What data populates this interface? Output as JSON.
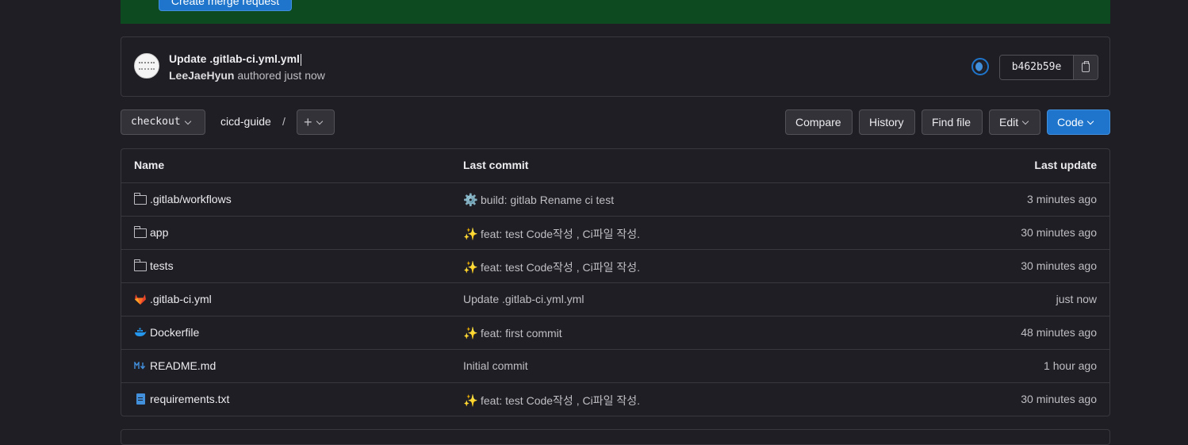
{
  "banner": {
    "button_label": "Create merge request"
  },
  "commit": {
    "title": "Update .gitlab-ci.yml.yml",
    "author": "LeeJaeHyun",
    "meta_suffix": "authored just now",
    "sha": "b462b59e"
  },
  "toolbar": {
    "branch": "checkout",
    "breadcrumb": "cicd-guide",
    "separator": "/",
    "add_symbol": "+",
    "compare": "Compare",
    "history": "History",
    "find_file": "Find file",
    "edit": "Edit",
    "code": "Code"
  },
  "table": {
    "headers": {
      "name": "Name",
      "last_commit": "Last commit",
      "last_update": "Last update"
    },
    "rows": [
      {
        "name": ".gitlab/workflows",
        "icon": "folder-icon",
        "commit_emoji": "⚙️",
        "commit": "build: gitlab Rename ci test",
        "updated": "3 minutes ago"
      },
      {
        "name": "app",
        "icon": "folder-icon",
        "commit_emoji": "✨",
        "commit": "feat: test Code작성 , Ci파일 작성.",
        "updated": "30 minutes ago"
      },
      {
        "name": "tests",
        "icon": "folder-icon",
        "commit_emoji": "✨",
        "commit": "feat: test Code작성 , Ci파일 작성.",
        "updated": "30 minutes ago"
      },
      {
        "name": ".gitlab-ci.yml",
        "icon": "gitlab-icon",
        "commit_emoji": "",
        "commit": "Update .gitlab-ci.yml.yml",
        "updated": "just now"
      },
      {
        "name": "Dockerfile",
        "icon": "docker-icon",
        "commit_emoji": "✨",
        "commit": "feat: first commit",
        "updated": "48 minutes ago"
      },
      {
        "name": "README.md",
        "icon": "markdown-icon",
        "commit_emoji": "",
        "commit": "Initial commit",
        "updated": "1 hour ago"
      },
      {
        "name": "requirements.txt",
        "icon": "text-file-icon",
        "commit_emoji": "✨",
        "commit": "feat: test Code작성 , Ci파일 작성.",
        "updated": "30 minutes ago"
      }
    ]
  },
  "colors": {
    "accent": "#1f75cb",
    "banner": "#0d4a20",
    "background": "#1f1e24"
  }
}
